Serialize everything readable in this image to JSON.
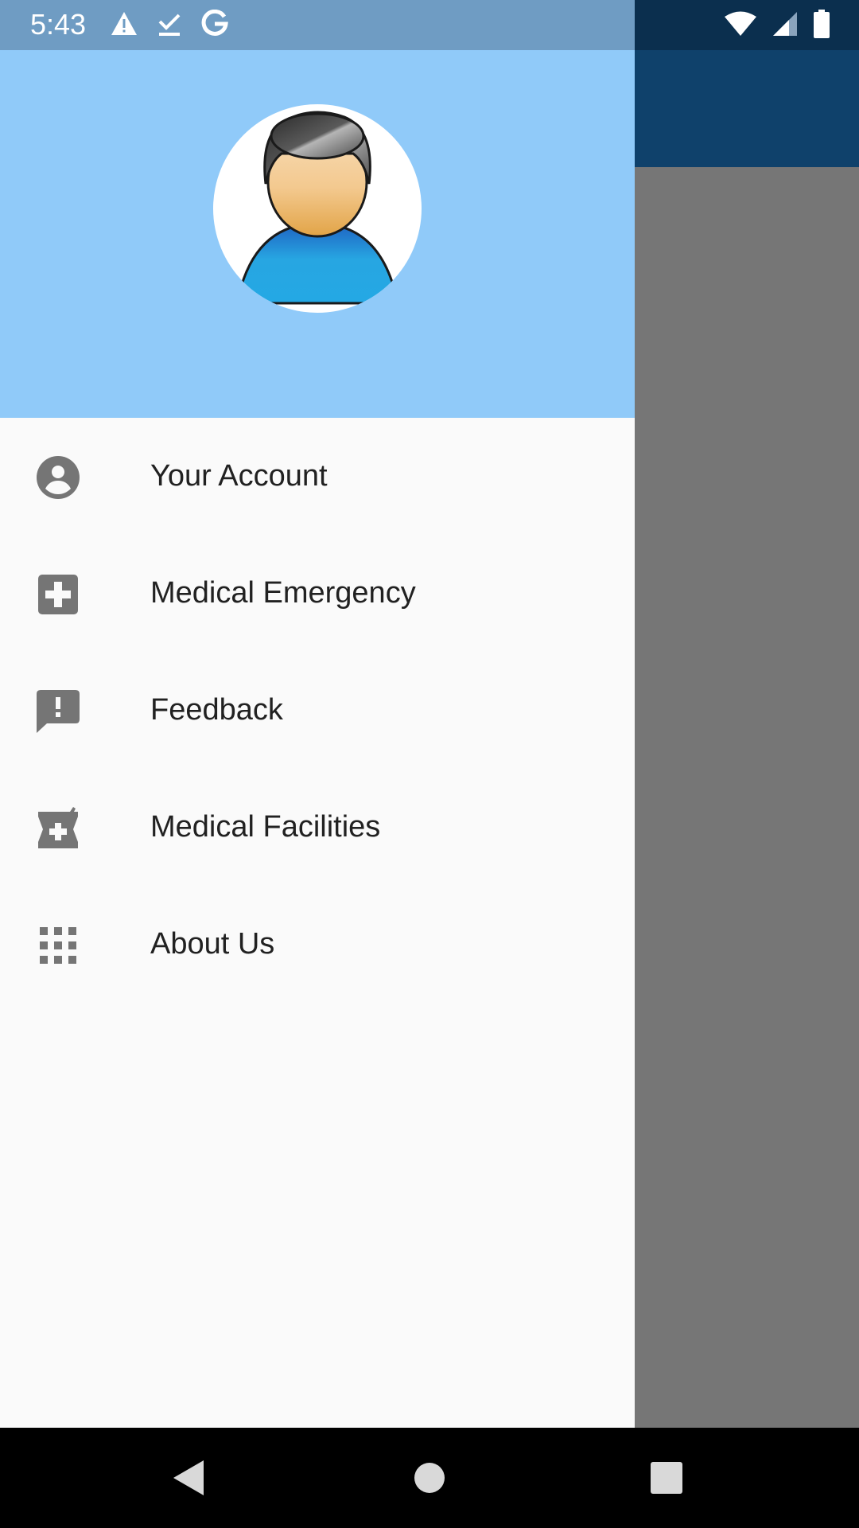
{
  "status_bar": {
    "time": "5:43",
    "left_icons": [
      "warning-icon",
      "download-done-icon",
      "google-icon"
    ],
    "right_icons": [
      "wifi-icon",
      "signal-icon",
      "battery-icon"
    ]
  },
  "drawer": {
    "header_color": "#90caf9",
    "avatar": "user-avatar",
    "items": [
      {
        "label": "Your Account",
        "icon": "account-circle-icon"
      },
      {
        "label": "Medical Emergency",
        "icon": "medical-cross-icon"
      },
      {
        "label": "Feedback",
        "icon": "feedback-icon"
      },
      {
        "label": "Medical Facilities",
        "icon": "pharmacy-icon"
      },
      {
        "label": "About Us",
        "icon": "apps-grid-icon"
      }
    ]
  },
  "nav_bar": {
    "buttons": [
      "back-icon",
      "home-icon",
      "recents-icon"
    ]
  },
  "colors": {
    "app_bar": "#0f416b",
    "scrim": "#767676",
    "drawer_bg": "#fafafa",
    "icon": "#757575",
    "text": "#212121"
  }
}
